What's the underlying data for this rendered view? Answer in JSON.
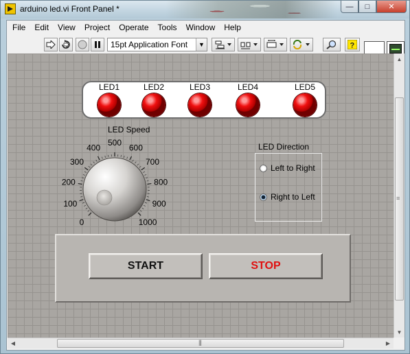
{
  "window": {
    "title": "arduino led.vi Front Panel *",
    "controls": {
      "minimize": "—",
      "maximize": "□",
      "close": "✕"
    }
  },
  "menu": [
    "File",
    "Edit",
    "View",
    "Project",
    "Operate",
    "Tools",
    "Window",
    "Help"
  ],
  "toolbar": {
    "font": "15pt Application Font",
    "icons": [
      "run-arrow-icon",
      "run-continuous-icon",
      "abort-icon",
      "pause-icon",
      "align-icon",
      "distribute-icon",
      "resize-icon",
      "reorder-icon",
      "search-icon",
      "help-icon"
    ]
  },
  "leds": {
    "items": [
      {
        "label": "LED1",
        "state": "on"
      },
      {
        "label": "LED2",
        "state": "on"
      },
      {
        "label": "LED3",
        "state": "on"
      },
      {
        "label": "LED4",
        "state": "on"
      },
      {
        "label": "LED5",
        "state": "on"
      }
    ],
    "color": "#f01010"
  },
  "speed_knob": {
    "label": "LED Speed",
    "ticks": [
      "0",
      "100",
      "200",
      "300",
      "400",
      "500",
      "600",
      "700",
      "800",
      "900",
      "1000"
    ],
    "min": 0,
    "max": 1000
  },
  "direction": {
    "label": "LED Direction",
    "options": [
      {
        "label": "Left to Right",
        "selected": false
      },
      {
        "label": "Right to Left",
        "selected": true
      }
    ]
  },
  "buttons": {
    "start": "START",
    "stop": "STOP",
    "stop_color": "#e01010"
  }
}
